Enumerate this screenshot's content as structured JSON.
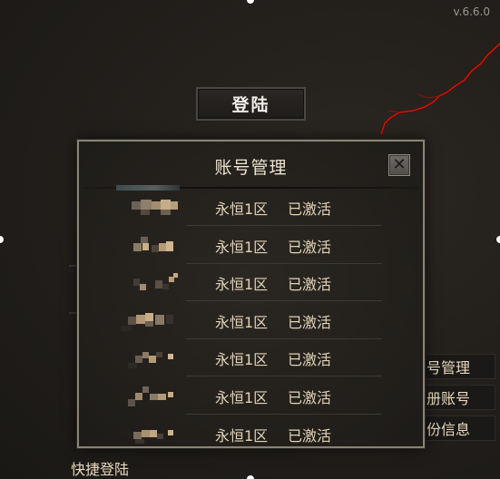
{
  "version": "v.6.6.0",
  "login_button": "登陆",
  "dialog": {
    "title": "账号管理",
    "close_icon": "close-icon",
    "accounts": [
      {
        "server": "永恒1区",
        "status": "已激活"
      },
      {
        "server": "永恒1区",
        "status": "已激活"
      },
      {
        "server": "永恒1区",
        "status": "已激活"
      },
      {
        "server": "永恒1区",
        "status": "已激活"
      },
      {
        "server": "永恒1区",
        "status": "已激活"
      },
      {
        "server": "永恒1区",
        "status": "已激活"
      },
      {
        "server": "永恒1区",
        "status": "已激活"
      }
    ]
  },
  "side_menu": [
    "号管理",
    "册账号",
    "份信息"
  ],
  "quick_login": "快捷登陆",
  "colors": {
    "text_gold": "#e3d3b7",
    "dialog_border": "#8b8274",
    "background": "#221f1b"
  }
}
